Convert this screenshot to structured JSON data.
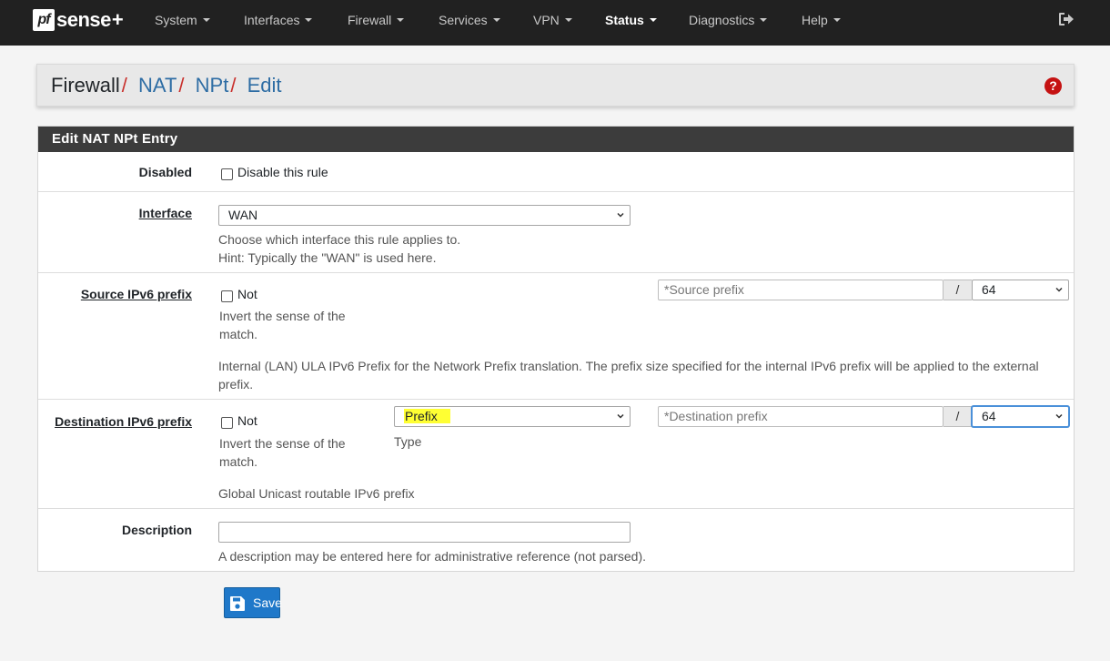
{
  "brand": {
    "pf": "pf",
    "sense": "sense",
    "plus": "+"
  },
  "nav": {
    "items": [
      "System",
      "Interfaces",
      "Firewall",
      "Services",
      "VPN",
      "Status",
      "Diagnostics",
      "Help"
    ],
    "active": "Status"
  },
  "breadcrumb": {
    "first": "Firewall",
    "sep": "/",
    "links": [
      "NAT",
      "NPt",
      "Edit"
    ]
  },
  "panel": {
    "title": "Edit NAT NPt Entry",
    "disabled": {
      "label": "Disabled",
      "checkbox_label": "Disable this rule",
      "checked": false
    },
    "interface": {
      "label": "Interface",
      "value": "WAN",
      "help1": "Choose which interface this rule applies to.",
      "help2": "Hint: Typically the \"WAN\" is used here."
    },
    "source": {
      "label": "Source IPv6 prefix",
      "not_label": "Not",
      "not_checked": false,
      "invert1": "Invert the sense of the",
      "invert2": "match.",
      "placeholder": "*Source prefix",
      "slash": "/",
      "mask": "64",
      "help1": "Internal (LAN) ULA IPv6 Prefix for the Network Prefix translation. The prefix size specified for the internal IPv6 prefix will be applied to the external",
      "help2": "prefix."
    },
    "destination": {
      "label": "Destination IPv6 prefix",
      "not_label": "Not",
      "not_checked": false,
      "invert1": "Invert the sense of the",
      "invert2": "match.",
      "type_value": "Prefix",
      "type_label": "Type",
      "placeholder": "*Destination prefix",
      "slash": "/",
      "mask": "64",
      "help": "Global Unicast routable IPv6 prefix"
    },
    "description": {
      "label": "Description",
      "value": "",
      "help": "A description may be entered here for administrative reference (not parsed)."
    }
  },
  "save_label": "Save",
  "icons": {
    "help": "question-circle-icon",
    "logout": "sign-out-icon",
    "save": "floppy-disk-icon"
  },
  "colors": {
    "navbar": "#212121",
    "heading": "#3c3c3c",
    "link": "#2e6da4",
    "separator": "#c9302c",
    "save": "#1f78c9",
    "highlight": "#ffff33"
  }
}
